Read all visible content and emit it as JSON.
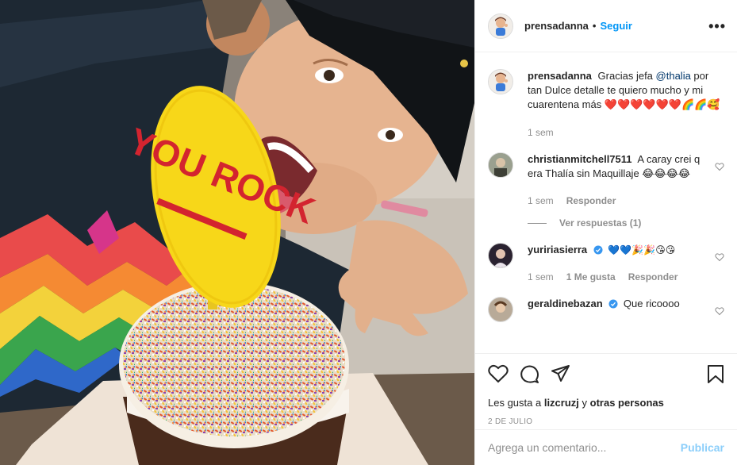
{
  "post": {
    "author": "prensadanna",
    "follow_label": "Seguir",
    "separator": "•",
    "more_label": "•••",
    "image_text": "YOU ROCK",
    "caption": {
      "username": "prensadanna",
      "text_before": "Gracias jefa ",
      "mention": "@thalia",
      "text_after": " por tan Dulce detalle te quiero mucho y mi cuarentena más ",
      "emojis": "❤️❤️❤️❤️❤️❤️🌈🌈🥰",
      "time": "1 sem"
    },
    "comments": [
      {
        "username": "christianmitchell7511",
        "text": "A caray crei q era Thalía sin Maquillaje 😂😂😂😂",
        "time": "1 sem",
        "reply_label": "Responder",
        "view_replies": "Ver respuestas (1)"
      },
      {
        "username": "yuririasierra",
        "verified": true,
        "text": "💙💙🎉🎉😘😘",
        "time": "1 sem",
        "likes": "1 Me gusta",
        "reply_label": "Responder"
      },
      {
        "username": "geraldinebazan",
        "verified": true,
        "text": "Que ricoooo"
      }
    ],
    "likes_prefix": "Les gusta a ",
    "likes_user": "lizcruzj",
    "likes_middle": " y ",
    "likes_others": "otras personas",
    "date": "2 DE JULIO",
    "comment_placeholder": "Agrega un comentario...",
    "publish_label": "Publicar"
  },
  "colors": {
    "accent": "#0095f6",
    "text": "#262626",
    "muted": "#8e8e8e",
    "verified": "#3897f0"
  },
  "icons": [
    "heart-icon",
    "comment-icon",
    "share-icon",
    "bookmark-icon",
    "more-options-icon",
    "verified-icon"
  ]
}
